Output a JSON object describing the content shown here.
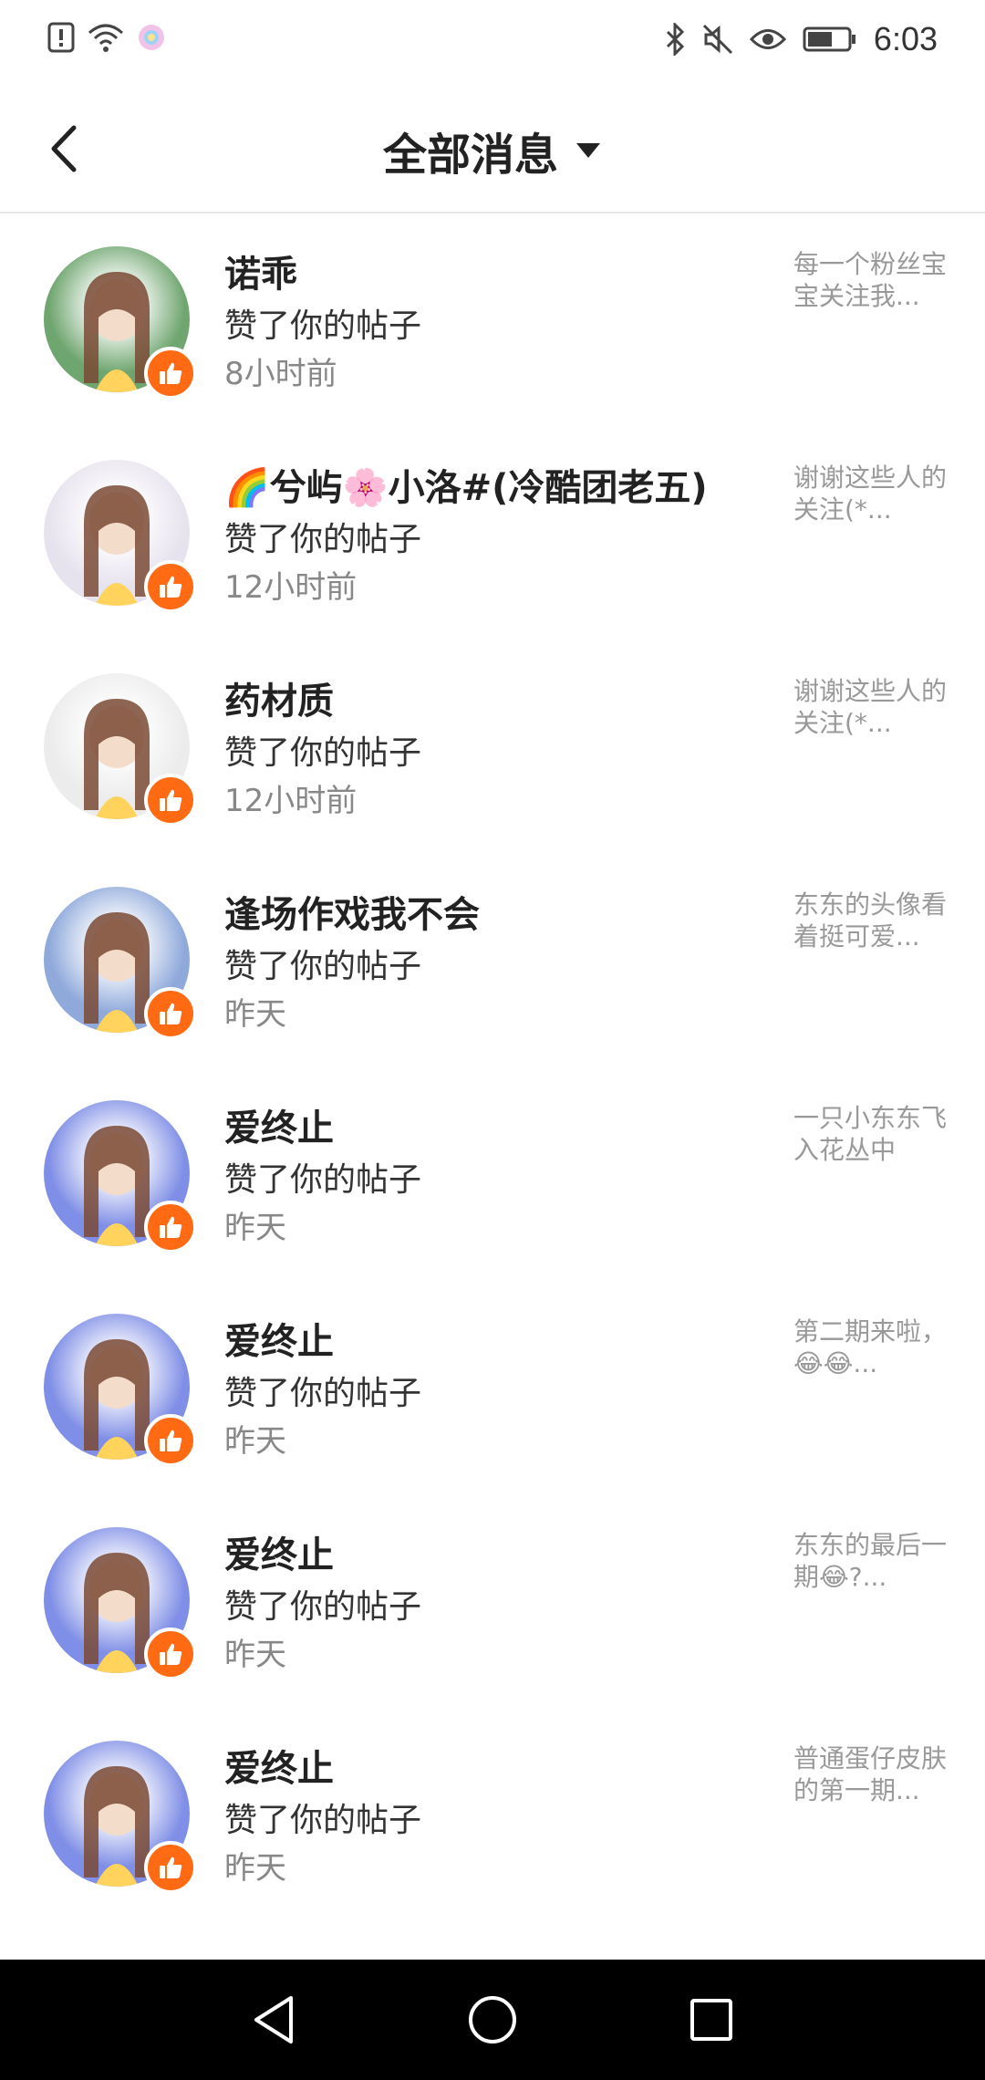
{
  "status_bar": {
    "time": "6:03",
    "icons_left": [
      "alert-icon",
      "wifi-icon",
      "app-icon"
    ],
    "icons_right": [
      "bluetooth-icon",
      "mute-icon",
      "eye-icon",
      "battery-icon"
    ]
  },
  "header": {
    "title": "全部消息",
    "back_icon": "chevron-left-icon",
    "dropdown_icon": "caret-down-icon"
  },
  "colors": {
    "accent": "#ff6a13",
    "text_primary": "#222222",
    "text_secondary": "#888888",
    "snippet": "#999999",
    "divider": "#e6e6e6"
  },
  "messages": [
    {
      "name": "诺乖",
      "action": "赞了你的帖子",
      "time": "8小时前",
      "snippet": "每一个粉丝宝宝关注我...",
      "avatar_color": "#6fa56f"
    },
    {
      "name": "🌈兮屿🌸小洛#(冷酷团老五)",
      "action": "赞了你的帖子",
      "time": "12小时前",
      "snippet": "谢谢这些人的关注(*...",
      "avatar_color": "#e7e3ee"
    },
    {
      "name": "药材质",
      "action": "赞了你的帖子",
      "time": "12小时前",
      "snippet": "谢谢这些人的关注(*...",
      "avatar_color": "#ececec"
    },
    {
      "name": "逢场作戏我不会",
      "action": "赞了你的帖子",
      "time": "昨天",
      "snippet": "东东的头像看着挺可爱...",
      "avatar_color": "#8fa9db"
    },
    {
      "name": "爱终止",
      "action": "赞了你的帖子",
      "time": "昨天",
      "snippet": "一只小东东飞入花丛中",
      "avatar_color": "#7f8ee6"
    },
    {
      "name": "爱终止",
      "action": "赞了你的帖子",
      "time": "昨天",
      "snippet": "第二期来啦，😂😂...",
      "avatar_color": "#7f8ee6"
    },
    {
      "name": "爱终止",
      "action": "赞了你的帖子",
      "time": "昨天",
      "snippet": "东东的最后一期😂?...",
      "avatar_color": "#7f8ee6"
    },
    {
      "name": "爱终止",
      "action": "赞了你的帖子",
      "time": "昨天",
      "snippet": "普通蛋仔皮肤的第一期...",
      "avatar_color": "#7f8ee6"
    }
  ],
  "nav_bar": {
    "buttons": [
      "back-triangle-icon",
      "home-circle-icon",
      "recents-square-icon"
    ]
  }
}
